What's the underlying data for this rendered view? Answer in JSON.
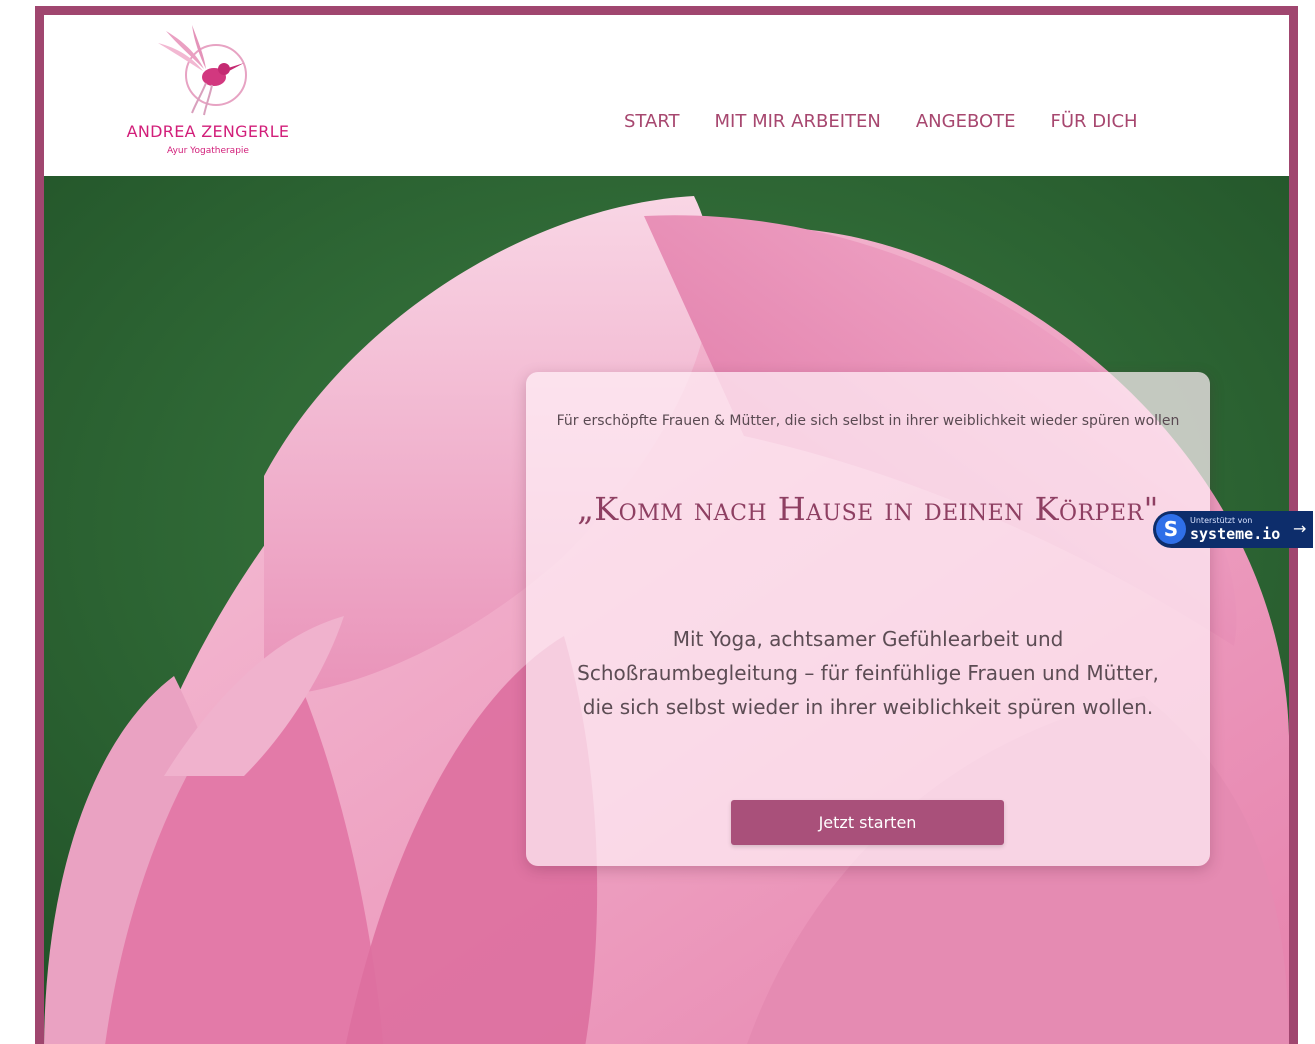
{
  "header": {
    "logo_name": "ANDREA ZENGERLE",
    "logo_subtitle": "Ayur Yogatherapie",
    "logo_icon": "hummingbird-logo-icon"
  },
  "nav": {
    "items": [
      {
        "label": "START"
      },
      {
        "label": "MIT MIR ARBEITEN"
      },
      {
        "label": "ANGEBOTE"
      },
      {
        "label": "FÜR DICH"
      }
    ]
  },
  "hero": {
    "background": "pink-lotus-bud-image",
    "tagline": "Für erschöpfte Frauen & Mütter, die sich selbst in ihrer weiblichkeit wieder spüren wollen",
    "title": "„Komm nach Hause in deinen Körper\"",
    "body": "Mit Yoga, achtsamer Gefühlearbeit und Schoßraumbegleitung – für feinfühlige Frauen und Mütter, die sich selbst wieder in ihrer weiblichkeit spüren wollen.",
    "cta_label": "Jetzt starten"
  },
  "badge": {
    "icon": "systeme-s-icon",
    "small_text": "Unterstützt von",
    "brand": "systeme.io",
    "arrow_icon": "arrow-right-icon"
  },
  "colors": {
    "frame": "#a0466f",
    "nav_text": "#a7476f",
    "logo": "#d21f7a",
    "title": "#8e3f62",
    "button": "#a9507a",
    "badge": "#0d2d6b"
  }
}
